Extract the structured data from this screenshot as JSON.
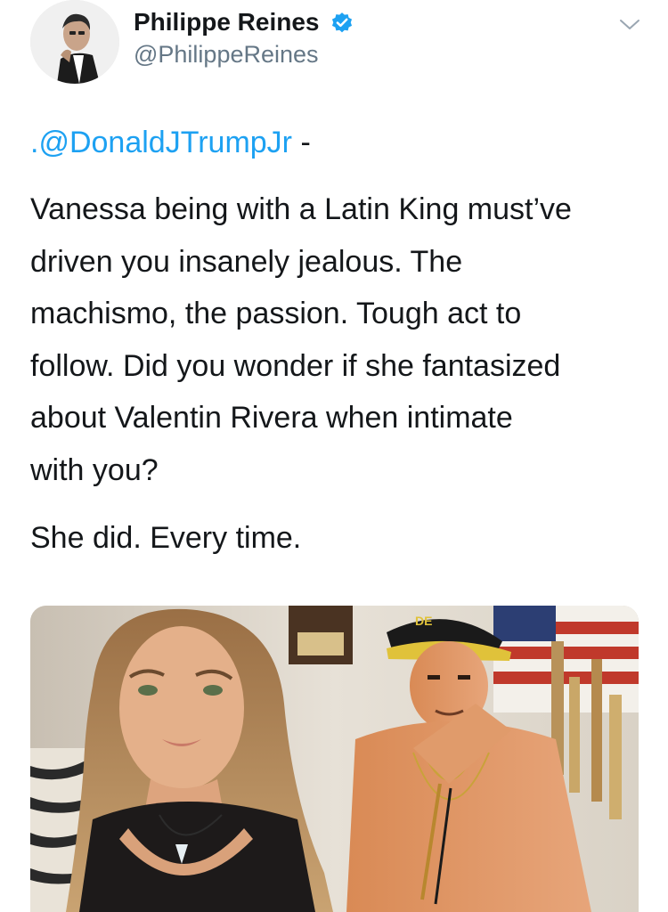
{
  "tweet": {
    "author_name": "Philippe Reines",
    "author_handle": "@PhilippeReines",
    "verified": true,
    "mention": ".@DonaldJTrumpJr",
    "mention_suffix": " -",
    "body_lines": [
      "Vanessa being with a Latin King must’ve",
      "driven you insanely jealous. The",
      "machismo, the passion. Tough act to",
      "follow. Did you wonder if she fantasized",
      "about Valentin Rivera when intimate",
      "with you?"
    ],
    "second_paragraph": "She did. Every time.",
    "plaque_text": "",
    "cap_text": "DE"
  },
  "icons": {
    "verified": "verified-badge-icon",
    "menu": "chevron-down-icon"
  },
  "colors": {
    "link": "#1da1f2",
    "verified": "#1da1f2",
    "text": "#14171a",
    "secondary": "#657786"
  }
}
